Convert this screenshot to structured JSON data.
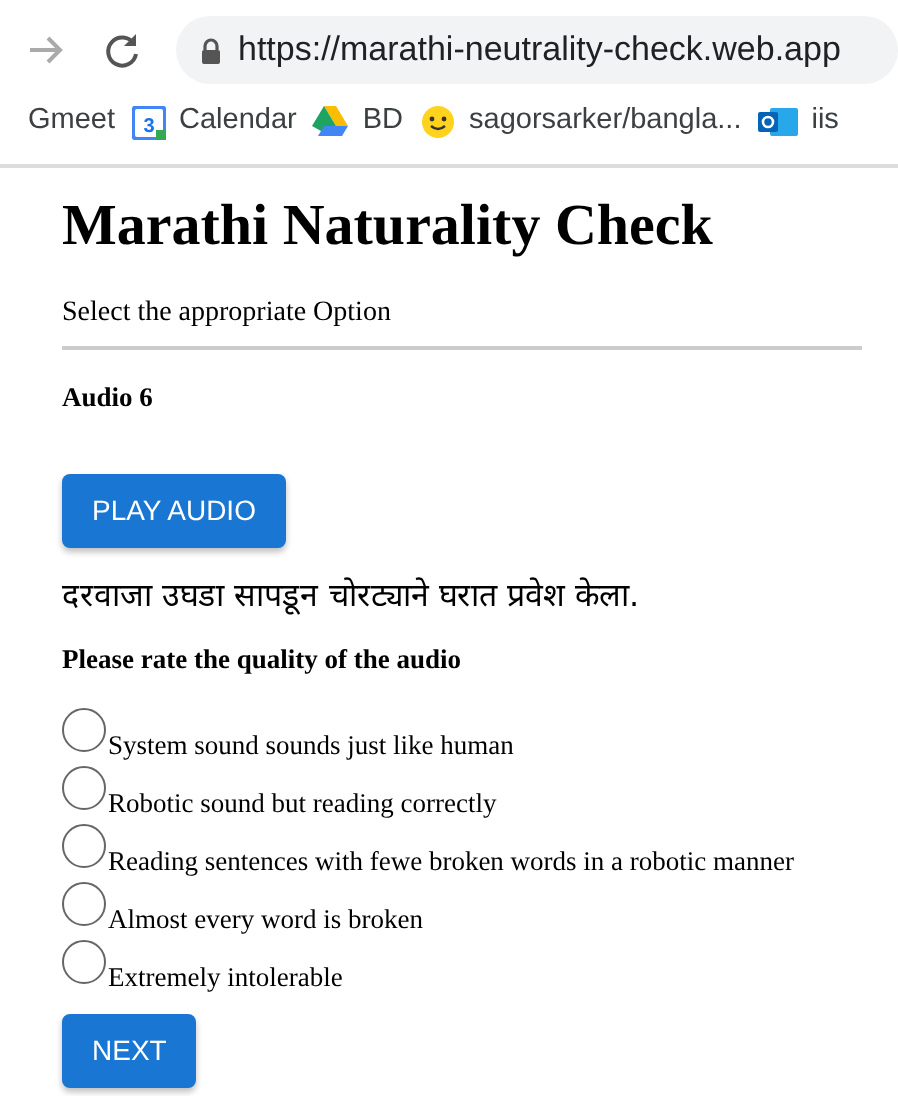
{
  "browser": {
    "url": "https://marathi-neutrality-check.web.app",
    "bookmarks": [
      {
        "kind": "none",
        "label": "Gmeet"
      },
      {
        "kind": "calendar",
        "icon_text": "3",
        "label": "Calendar"
      },
      {
        "kind": "drive",
        "label": "BD"
      },
      {
        "kind": "face",
        "label": "sagorsarker/bangla..."
      },
      {
        "kind": "mail",
        "label": "iis"
      }
    ]
  },
  "page": {
    "title": "Marathi Naturality Check",
    "subtitle": "Select the appropriate Option",
    "audio_label": "Audio 6",
    "play_button": "PLAY AUDIO",
    "sentence": "दरवाजा उघडा सापडून चोरट्याने घरात प्रवेश केला.",
    "question": "Please rate the quality of the audio",
    "options": [
      {
        "label": "System sound sounds just like human",
        "selected": false
      },
      {
        "label": "Robotic sound but reading correctly",
        "selected": false
      },
      {
        "label": "Reading sentences with fewe broken words in a robotic manner",
        "selected": false
      },
      {
        "label": "Almost every word is broken",
        "selected": false
      },
      {
        "label": "Extremely intolerable",
        "selected": false
      }
    ],
    "next_button": "NEXT"
  }
}
